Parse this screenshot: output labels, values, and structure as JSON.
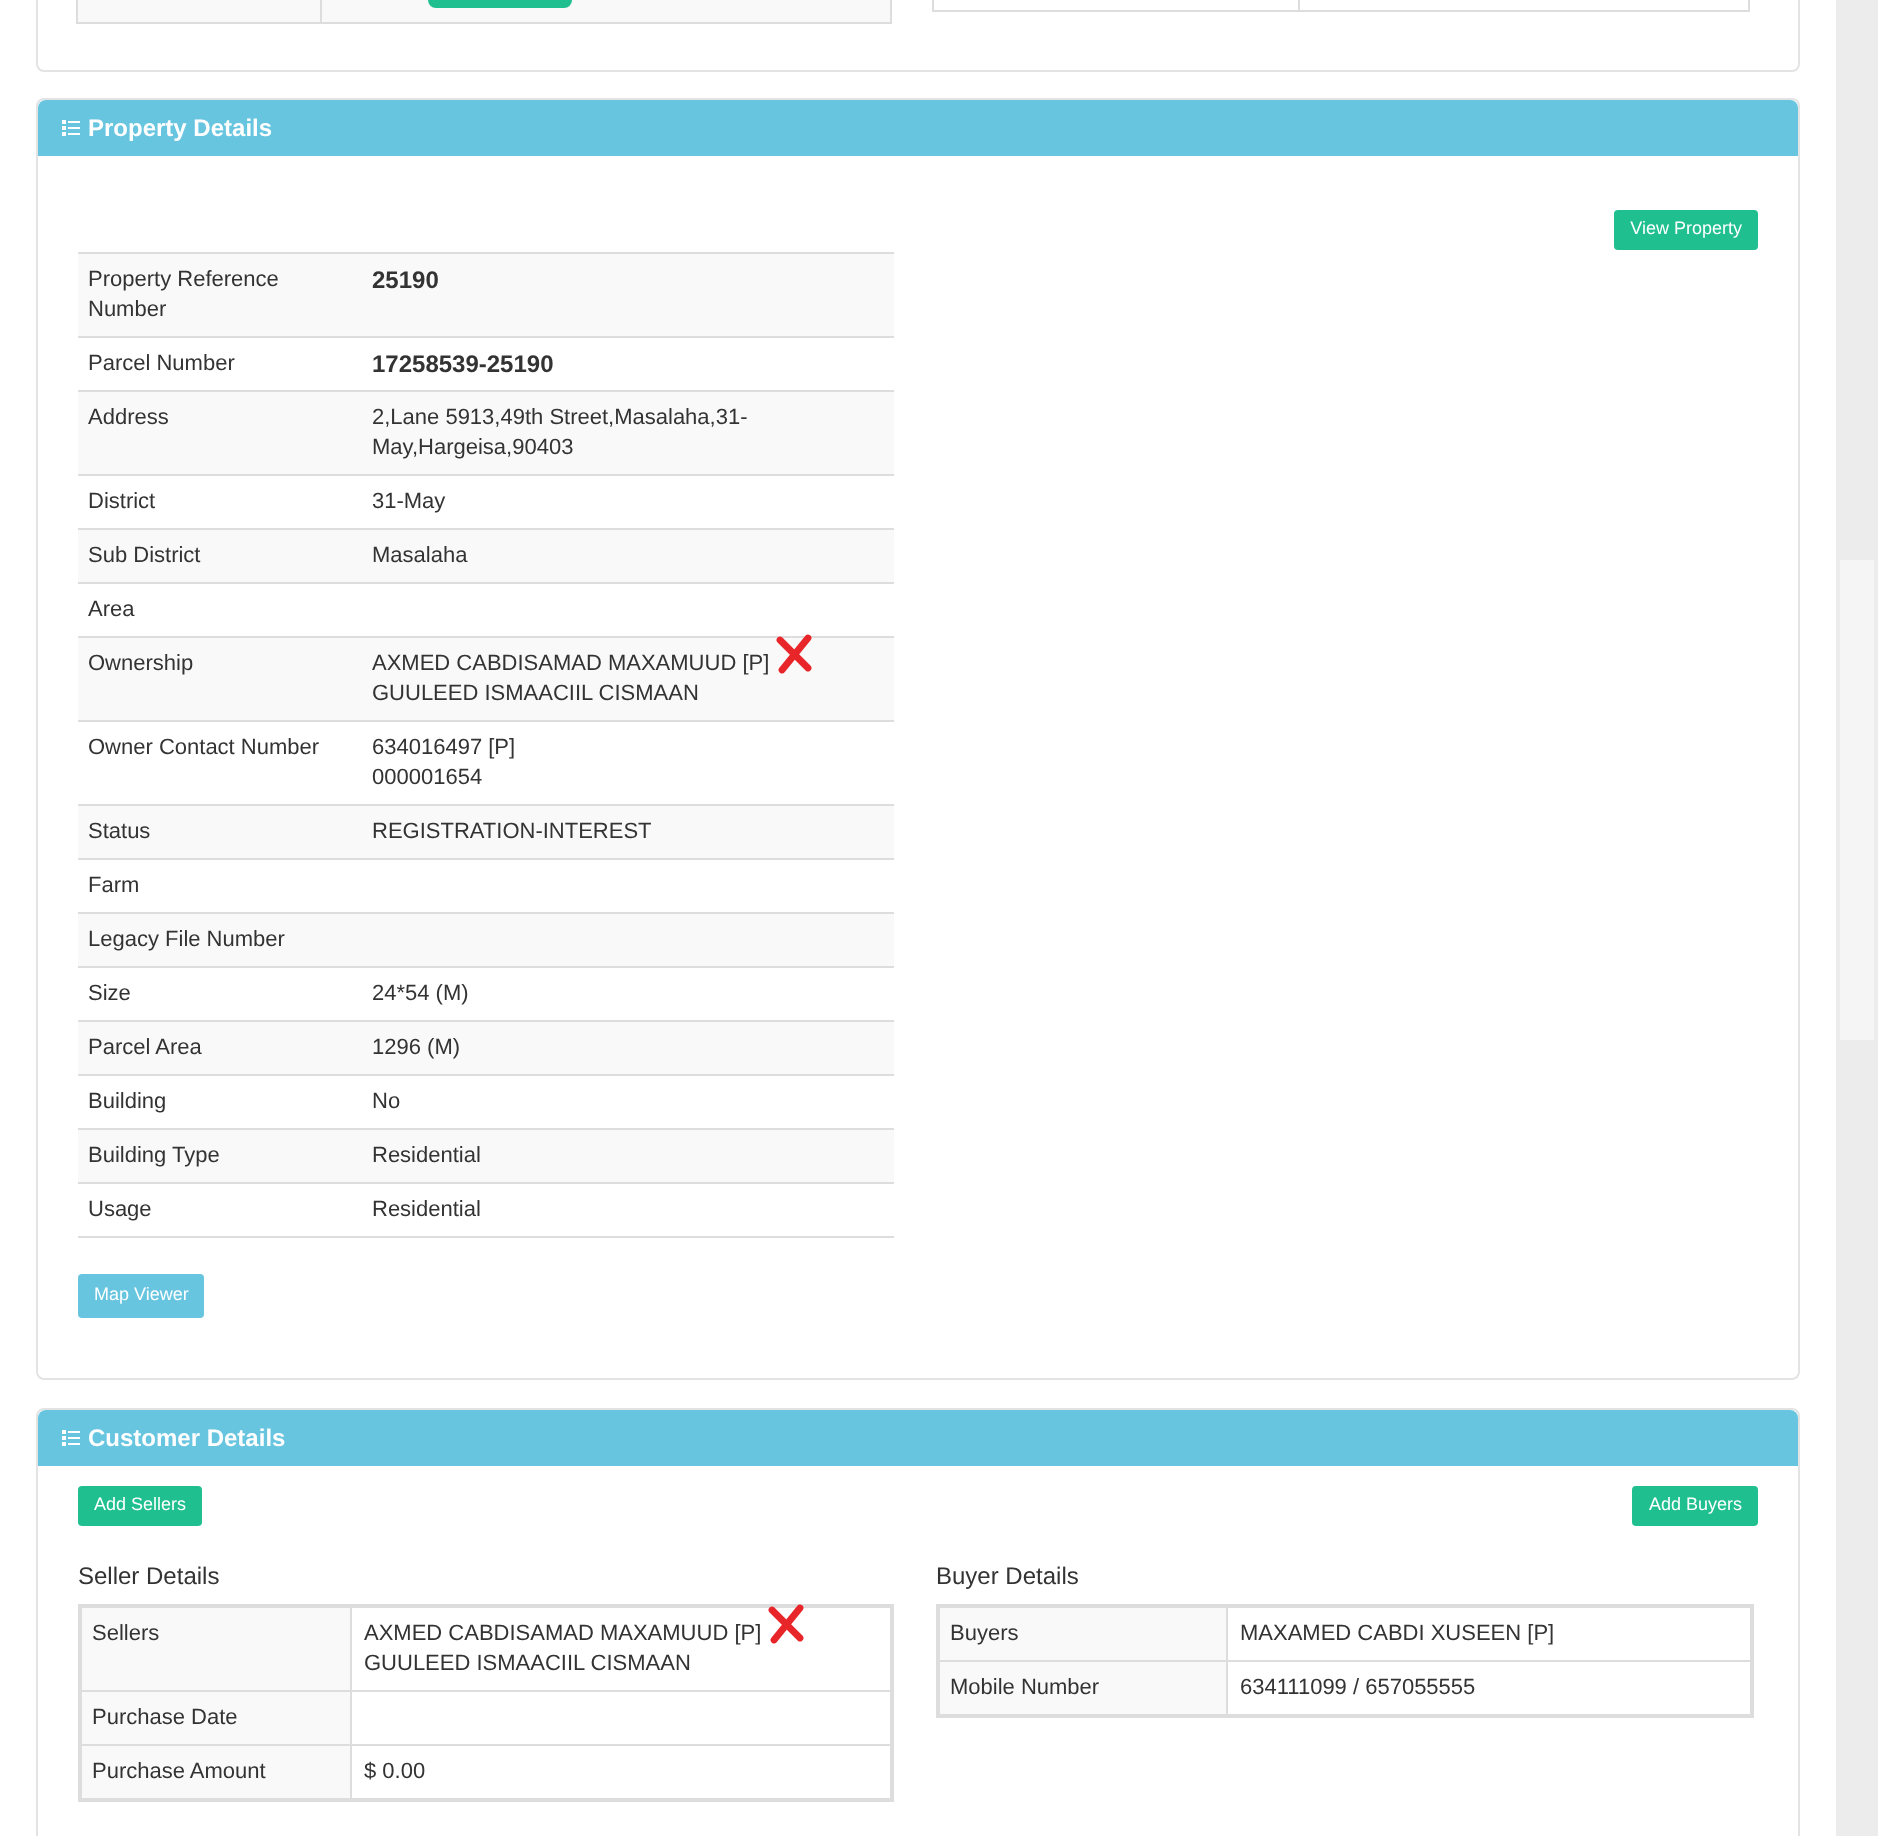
{
  "property_details": {
    "title": "Property Details",
    "view_button": "View Property",
    "rows": [
      {
        "label": "Property Reference Number",
        "lines": [
          "25190"
        ],
        "bold": true,
        "crossed": false
      },
      {
        "label": "Parcel Number",
        "lines": [
          "17258539-25190"
        ],
        "bold": true,
        "crossed": false
      },
      {
        "label": "Address",
        "lines": [
          "2,Lane 5913,49th Street,Masalaha,31-",
          "May,Hargeisa,90403"
        ],
        "bold": false,
        "crossed": false
      },
      {
        "label": "District",
        "lines": [
          "31-May"
        ],
        "bold": false,
        "crossed": false
      },
      {
        "label": "Sub District",
        "lines": [
          "Masalaha"
        ],
        "bold": false,
        "crossed": false
      },
      {
        "label": "Area",
        "lines": [],
        "crossed": false
      },
      {
        "label": "Ownership",
        "lines": [
          "AXMED CABDISAMAD MAXAMUUD [P]",
          "GUULEED ISMAACIIL CISMAAN"
        ],
        "bold": false,
        "crossed": true
      },
      {
        "label": "Owner Contact Number",
        "lines": [
          "634016497 [P]",
          "000001654"
        ],
        "bold": false,
        "crossed": false
      },
      {
        "label": "Status",
        "lines": [
          "REGISTRATION-INTEREST"
        ],
        "bold": false,
        "crossed": false
      },
      {
        "label": "Farm",
        "lines": [],
        "crossed": false
      },
      {
        "label": "Legacy File Number",
        "lines": [],
        "crossed": false
      },
      {
        "label": "Size",
        "lines": [
          "24*54 (M)"
        ],
        "bold": false,
        "crossed": false
      },
      {
        "label": "Parcel Area",
        "lines": [
          "1296 (M)"
        ],
        "bold": false,
        "crossed": false
      },
      {
        "label": "Building",
        "lines": [
          "No"
        ],
        "bold": false,
        "crossed": false
      },
      {
        "label": "Building Type",
        "lines": [
          "Residential"
        ],
        "bold": false,
        "crossed": false
      },
      {
        "label": "Usage",
        "lines": [
          "Residential"
        ],
        "bold": false,
        "crossed": false
      }
    ],
    "map_button": "Map Viewer"
  },
  "customer_details": {
    "title": "Customer Details",
    "add_sellers": "Add Sellers",
    "add_buyers": "Add Buyers",
    "seller_title": "Seller Details",
    "seller_rows": [
      {
        "label": "Sellers",
        "lines": [
          "AXMED CABDISAMAD MAXAMUUD [P]",
          "GUULEED ISMAACIIL CISMAAN"
        ],
        "crossed": true
      },
      {
        "label": "Purchase Date",
        "lines": [],
        "crossed": false
      },
      {
        "label": "Purchase Amount",
        "lines": [
          "$ 0.00"
        ],
        "crossed": false
      }
    ],
    "buyer_title": "Buyer Details",
    "buyer_rows": [
      {
        "label": "Buyers",
        "lines": [
          "MAXAMED CABDI XUSEEN [P]"
        ],
        "crossed": false
      },
      {
        "label": "Mobile Number",
        "lines": [
          "634111099 / 657055555"
        ],
        "crossed": false
      }
    ]
  }
}
